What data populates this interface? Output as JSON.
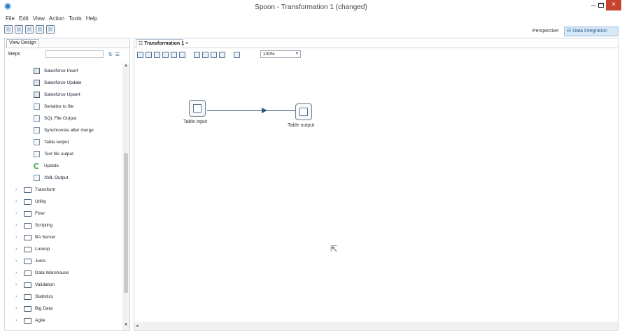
{
  "window": {
    "title": "Spoon - Transformation 1 (changed)",
    "min": "–",
    "close": "×"
  },
  "menu": [
    "File",
    "Edit",
    "View",
    "Action",
    "Tools",
    "Help"
  ],
  "perspective": {
    "label": "Perspective:",
    "value": "Data Integration"
  },
  "left_panel": {
    "tab_label": "View  Design",
    "steps_label": "Steps",
    "search_placeholder": "",
    "tools": "⇅ ☰",
    "leaf_items": [
      {
        "label": "Salesforce Insert",
        "icon": "salesforce-icon"
      },
      {
        "label": "Salesforce Update",
        "icon": "salesforce-icon"
      },
      {
        "label": "Salesforce Upsert",
        "icon": "salesforce-icon"
      },
      {
        "label": "Serialize to file",
        "icon": "file-icon"
      },
      {
        "label": "SQL File Output",
        "icon": "file-icon"
      },
      {
        "label": "Synchronize after merge",
        "icon": "sync-icon"
      },
      {
        "label": "Table output",
        "icon": "table-icon"
      },
      {
        "label": "Text file output",
        "icon": "file-icon"
      },
      {
        "label": "Update",
        "icon": "update-icon"
      },
      {
        "label": "XML Output",
        "icon": "xml-icon"
      }
    ],
    "folders": [
      "Transform",
      "Utility",
      "Flow",
      "Scripting",
      "BA Server",
      "Lookup",
      "Joins",
      "Data Warehouse",
      "Validation",
      "Statistics",
      "Big Data",
      "Agile"
    ]
  },
  "doc_tab": {
    "label": "Transformation 1",
    "close": "×"
  },
  "zoom": "100%",
  "canvas": {
    "steps": [
      {
        "label": "Table input"
      },
      {
        "label": "Table output"
      }
    ]
  }
}
